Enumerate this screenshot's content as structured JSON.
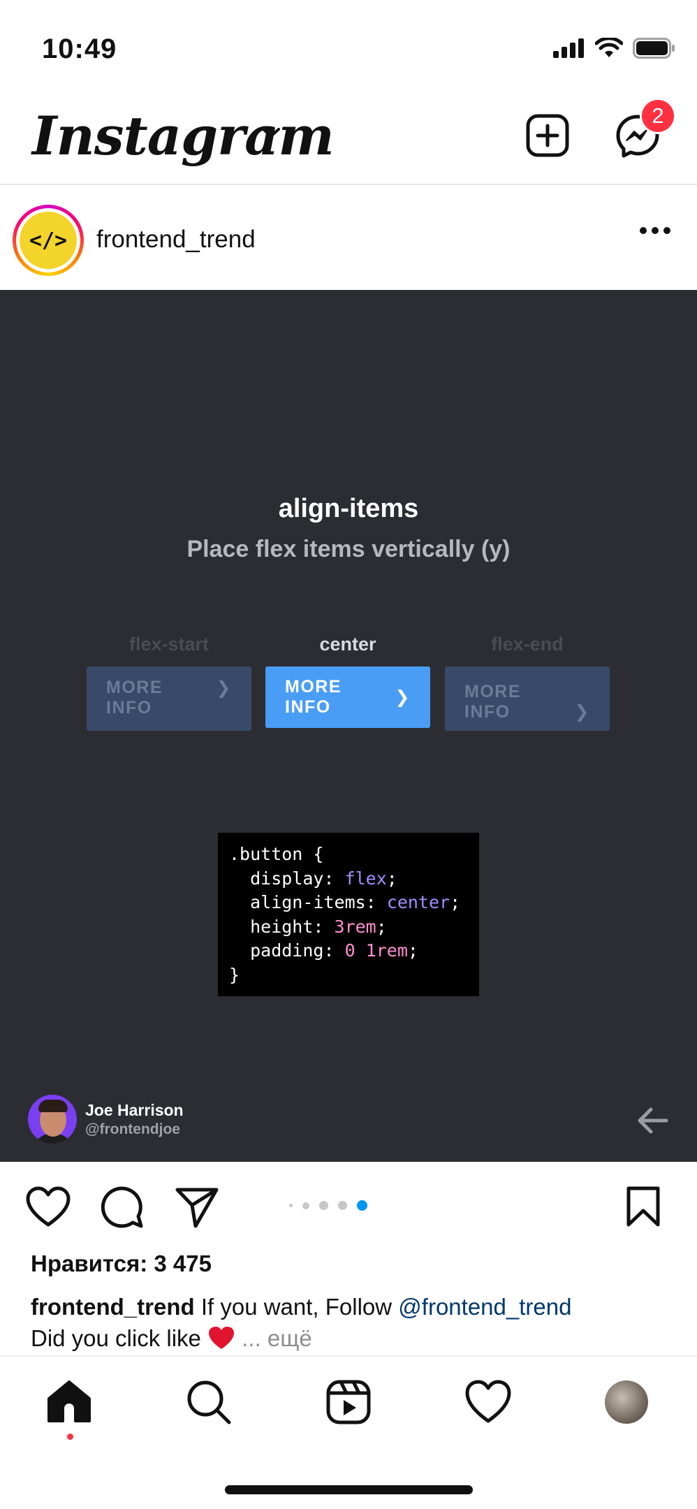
{
  "status_bar": {
    "time": "10:49"
  },
  "header": {
    "brand": "Instagram",
    "message_badge": "2"
  },
  "post": {
    "username": "frontend_trend",
    "avatar_text": "</>",
    "media": {
      "title": "align-items",
      "subtitle": "Place flex items vertically (y)",
      "demos": [
        {
          "label": "flex-start",
          "button": "MORE INFO"
        },
        {
          "label": "center",
          "button": "MORE INFO"
        },
        {
          "label": "flex-end",
          "button": "MORE INFO"
        }
      ],
      "code": {
        "l1": ".button {",
        "l2_prop": "  display: ",
        "l2_val": "flex",
        "l3_prop": "  align-items: ",
        "l3_val": "center",
        "l4_prop": "  height: ",
        "l4_val": "3rem",
        "l5_prop": "  padding: ",
        "l5_val": "0 1rem",
        "l6": "}"
      },
      "author_name": "Joe Harrison",
      "author_handle": "@frontendjoe"
    },
    "carousel": {
      "count": 5,
      "active": 5
    },
    "likes": "Нравится: 3 475",
    "caption": {
      "username": "frontend_trend",
      "text1": " If you want, Follow ",
      "mention": "@frontend_trend",
      "text2": "Did you click like ",
      "ellipsis": " ... ",
      "more": "ещё"
    }
  },
  "colors": {
    "accent_blue": "#4a9df5",
    "media_bg": "#2c2d33",
    "badge_red": "#ff3040",
    "link_blue": "#00376b",
    "carousel_active": "#0095f6"
  }
}
